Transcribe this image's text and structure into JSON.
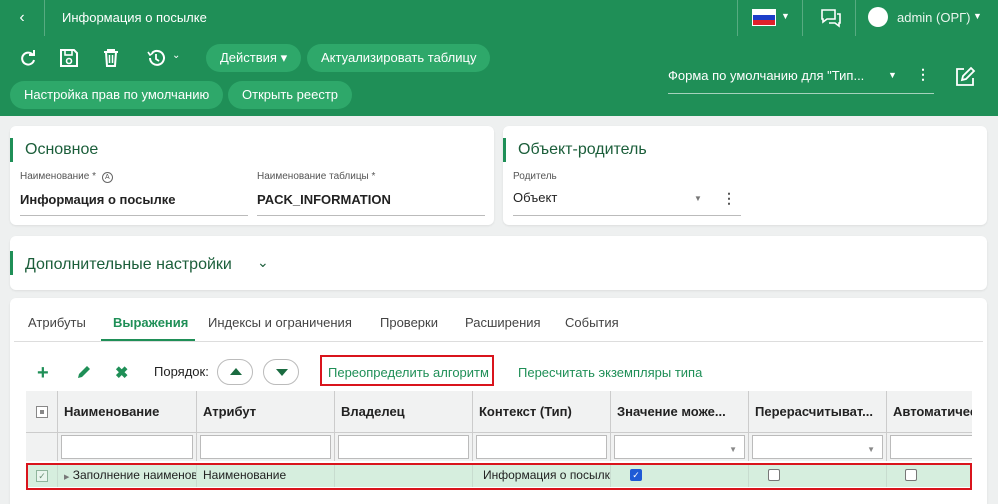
{
  "header": {
    "back_icon": "chevron-left-icon",
    "title": "Информация о посылке",
    "language_flag": "ru-flag",
    "chat_icon": "chat-icon",
    "user": "admin (ОРГ)"
  },
  "toolbar": {
    "icons": [
      "refresh-icon",
      "save-icon",
      "delete-icon",
      "history-icon"
    ],
    "actions_label": "Действия",
    "update_table_label": "Актуализировать таблицу",
    "default_rights_label": "Настройка прав по умолчанию",
    "open_registry_label": "Открыть реестр",
    "form_select_value": "Форма по умолчанию для \"Тип...",
    "edit_icon": "edit-icon"
  },
  "main_card": {
    "title": "Основное",
    "name_label": "Наименование *",
    "name_value": "Информация о посылке",
    "table_name_label": "Наименование таблицы *",
    "table_name_value": "PACK_INFORMATION"
  },
  "parent_card": {
    "title": "Объект-родитель",
    "parent_label": "Родитель",
    "parent_value": "Объект"
  },
  "extra_settings": {
    "title": "Дополнительные настройки"
  },
  "tabs": [
    {
      "label": "Атрибуты"
    },
    {
      "label": "Выражения"
    },
    {
      "label": "Индексы и ограничения"
    },
    {
      "label": "Проверки"
    },
    {
      "label": "Расширения"
    },
    {
      "label": "События"
    }
  ],
  "actions": {
    "order_label": "Порядок:",
    "override_label": "Переопределить алгоритм",
    "recalc_label": "Пересчитать экземпляры типа"
  },
  "grid": {
    "columns": [
      "Наименование",
      "Атрибут",
      "Владелец",
      "Контекст (Тип)",
      "Значение може...",
      "Перерасчитыват...",
      "Автоматичес"
    ],
    "rows": [
      {
        "checked": true,
        "name": "Заполнение наименова",
        "attribute": "Наименование",
        "owner": "",
        "context": "Информация о посылке",
        "value_may": true,
        "recalc": false,
        "auto": false
      }
    ]
  },
  "colors": {
    "brand": "#1f8f57",
    "highlight": "#d9141c"
  }
}
